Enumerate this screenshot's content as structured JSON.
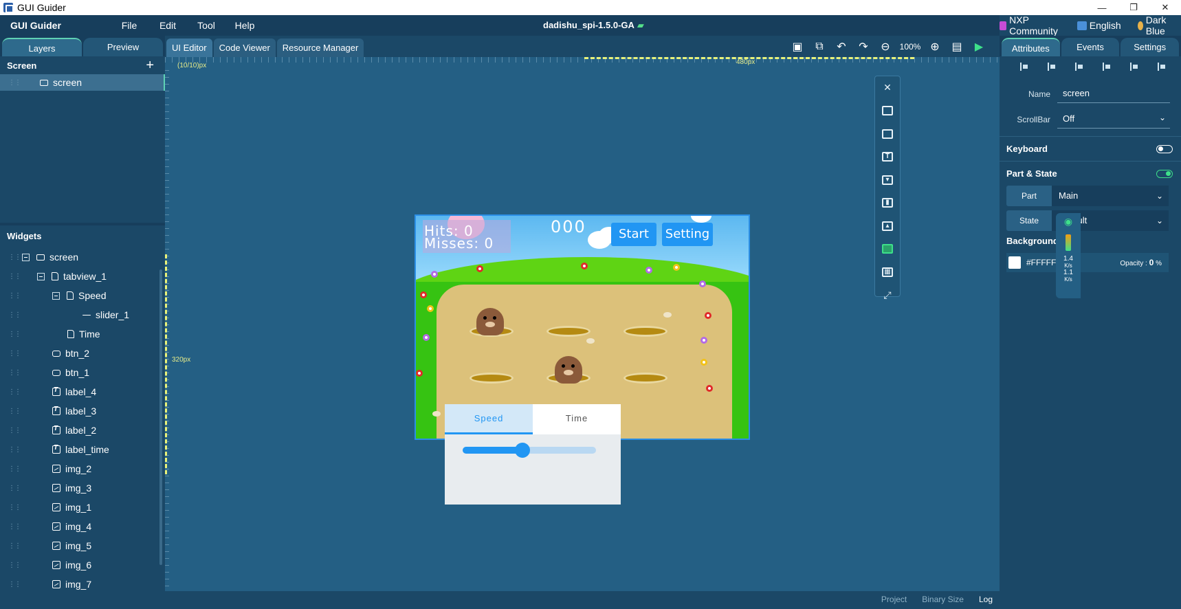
{
  "window": {
    "title": "GUI Guider",
    "minimize": "—",
    "restore": "❐",
    "close": "✕"
  },
  "menubar": {
    "brand": "GUI Guider",
    "menus": [
      "File",
      "Edit",
      "Tool",
      "Help"
    ],
    "project": "dadishu_spi-1.5.0-GA",
    "community": "NXP Community",
    "language": "English",
    "theme": "Dark Blue"
  },
  "left": {
    "tabs": [
      "Layers",
      "Preview"
    ],
    "screen_section": "Screen",
    "screen_item": "screen",
    "widgets_section": "Widgets",
    "tree": [
      {
        "label": "screen",
        "icon": "screen-icon",
        "depth": 0,
        "toggle": true
      },
      {
        "label": "tabview_1",
        "icon": "page-icon",
        "depth": 1,
        "toggle": true
      },
      {
        "label": "Speed",
        "icon": "page-icon",
        "depth": 2,
        "toggle": true
      },
      {
        "label": "slider_1",
        "icon": "slider-icon",
        "depth": 3,
        "toggle": false
      },
      {
        "label": "Time",
        "icon": "page-icon",
        "depth": 2,
        "toggle": false
      },
      {
        "label": "btn_2",
        "icon": "button-icon",
        "depth": 1,
        "toggle": false
      },
      {
        "label": "btn_1",
        "icon": "button-icon",
        "depth": 1,
        "toggle": false
      },
      {
        "label": "label_4",
        "icon": "label-icon",
        "depth": 1,
        "toggle": false
      },
      {
        "label": "label_3",
        "icon": "label-icon",
        "depth": 1,
        "toggle": false
      },
      {
        "label": "label_2",
        "icon": "label-icon",
        "depth": 1,
        "toggle": false
      },
      {
        "label": "label_time",
        "icon": "label-icon",
        "depth": 1,
        "toggle": false
      },
      {
        "label": "img_2",
        "icon": "image-icon",
        "depth": 1,
        "toggle": false
      },
      {
        "label": "img_3",
        "icon": "image-icon",
        "depth": 1,
        "toggle": false
      },
      {
        "label": "img_1",
        "icon": "image-icon",
        "depth": 1,
        "toggle": false
      },
      {
        "label": "img_4",
        "icon": "image-icon",
        "depth": 1,
        "toggle": false
      },
      {
        "label": "img_5",
        "icon": "image-icon",
        "depth": 1,
        "toggle": false
      },
      {
        "label": "img_6",
        "icon": "image-icon",
        "depth": 1,
        "toggle": false
      },
      {
        "label": "img_7",
        "icon": "image-icon",
        "depth": 1,
        "toggle": false
      }
    ]
  },
  "center": {
    "tabs": [
      "UI Editor",
      "Code Viewer",
      "Resource Manager"
    ],
    "zoom": "100%",
    "coord_label": "(10/10)px",
    "width_label": "480px",
    "height_label": "320px",
    "game": {
      "hits": "Hits:  0",
      "misses": "Misses:  0",
      "score": "000",
      "start_button": "Start",
      "setting_button": "Setting"
    },
    "tabview": {
      "tabs": [
        "Speed",
        "Time"
      ],
      "slider_value": 0.45
    },
    "bottom": {
      "project": "Project",
      "binary_size": "Binary Size",
      "log": "Log"
    }
  },
  "right": {
    "tabs": [
      "Attributes",
      "Events",
      "Settings"
    ],
    "name_label": "Name",
    "name_value": "screen",
    "scrollbar_label": "ScrollBar",
    "scrollbar_value": "Off",
    "keyboard": "Keyboard",
    "keyboard_toggle": "OFF",
    "part_state": "Part & State",
    "part_state_toggle": "ON",
    "part_label": "Part",
    "part_value": "Main",
    "state_label": "State",
    "state_value": "Default",
    "background": "Background",
    "bg_color": "#FFFFFF",
    "opacity_label": "Opacity :",
    "opacity_value": "0",
    "opacity_unit": "%"
  },
  "meter": {
    "up": "1.4",
    "down": "1.1",
    "unit": "K/s"
  },
  "colors": {
    "accent": "#2196f3",
    "panel": "#1b4867",
    "canvas": "#245f84",
    "teal": "#5fd2b5"
  }
}
